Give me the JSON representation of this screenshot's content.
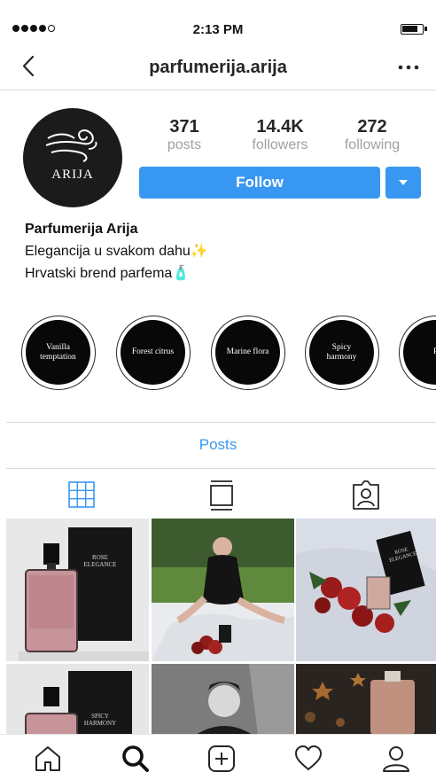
{
  "status_bar": {
    "time": "2:13 PM"
  },
  "header": {
    "username": "parfumerija.arija"
  },
  "profile": {
    "avatar_text": "ARIJA",
    "stats": [
      {
        "value": "371",
        "label": "posts"
      },
      {
        "value": "14.4K",
        "label": "followers"
      },
      {
        "value": "272",
        "label": "following"
      }
    ],
    "follow_label": "Follow",
    "name": "Parfumerija Arija",
    "bio_line1": "Elegancija u svakom dahu✨",
    "bio_line2": "Hrvatski brend parfema🧴"
  },
  "highlights": [
    "Vanilla temptation",
    "Forest citrus",
    "Marine flora",
    "Spicy harmony",
    "Ro ele"
  ],
  "section_label": "Posts",
  "tabs": [
    "grid-icon",
    "feed-icon",
    "tagged-icon"
  ],
  "grid": {
    "bottles": {
      "p1": {
        "line1": "ROSE",
        "line2": "ELEGANCE"
      },
      "p4": {
        "line1": "SPICY",
        "line2": "HARMONY"
      },
      "p3": {
        "line1": "ROSE",
        "line2": "ELEGANCE"
      }
    }
  },
  "bottom_tabs": [
    "home-icon",
    "search-icon",
    "new-post-icon",
    "activity-icon",
    "profile-icon"
  ],
  "colors": {
    "accent": "#3897f0",
    "muted": "#a0a0a0",
    "divider": "#dbdbdb"
  }
}
